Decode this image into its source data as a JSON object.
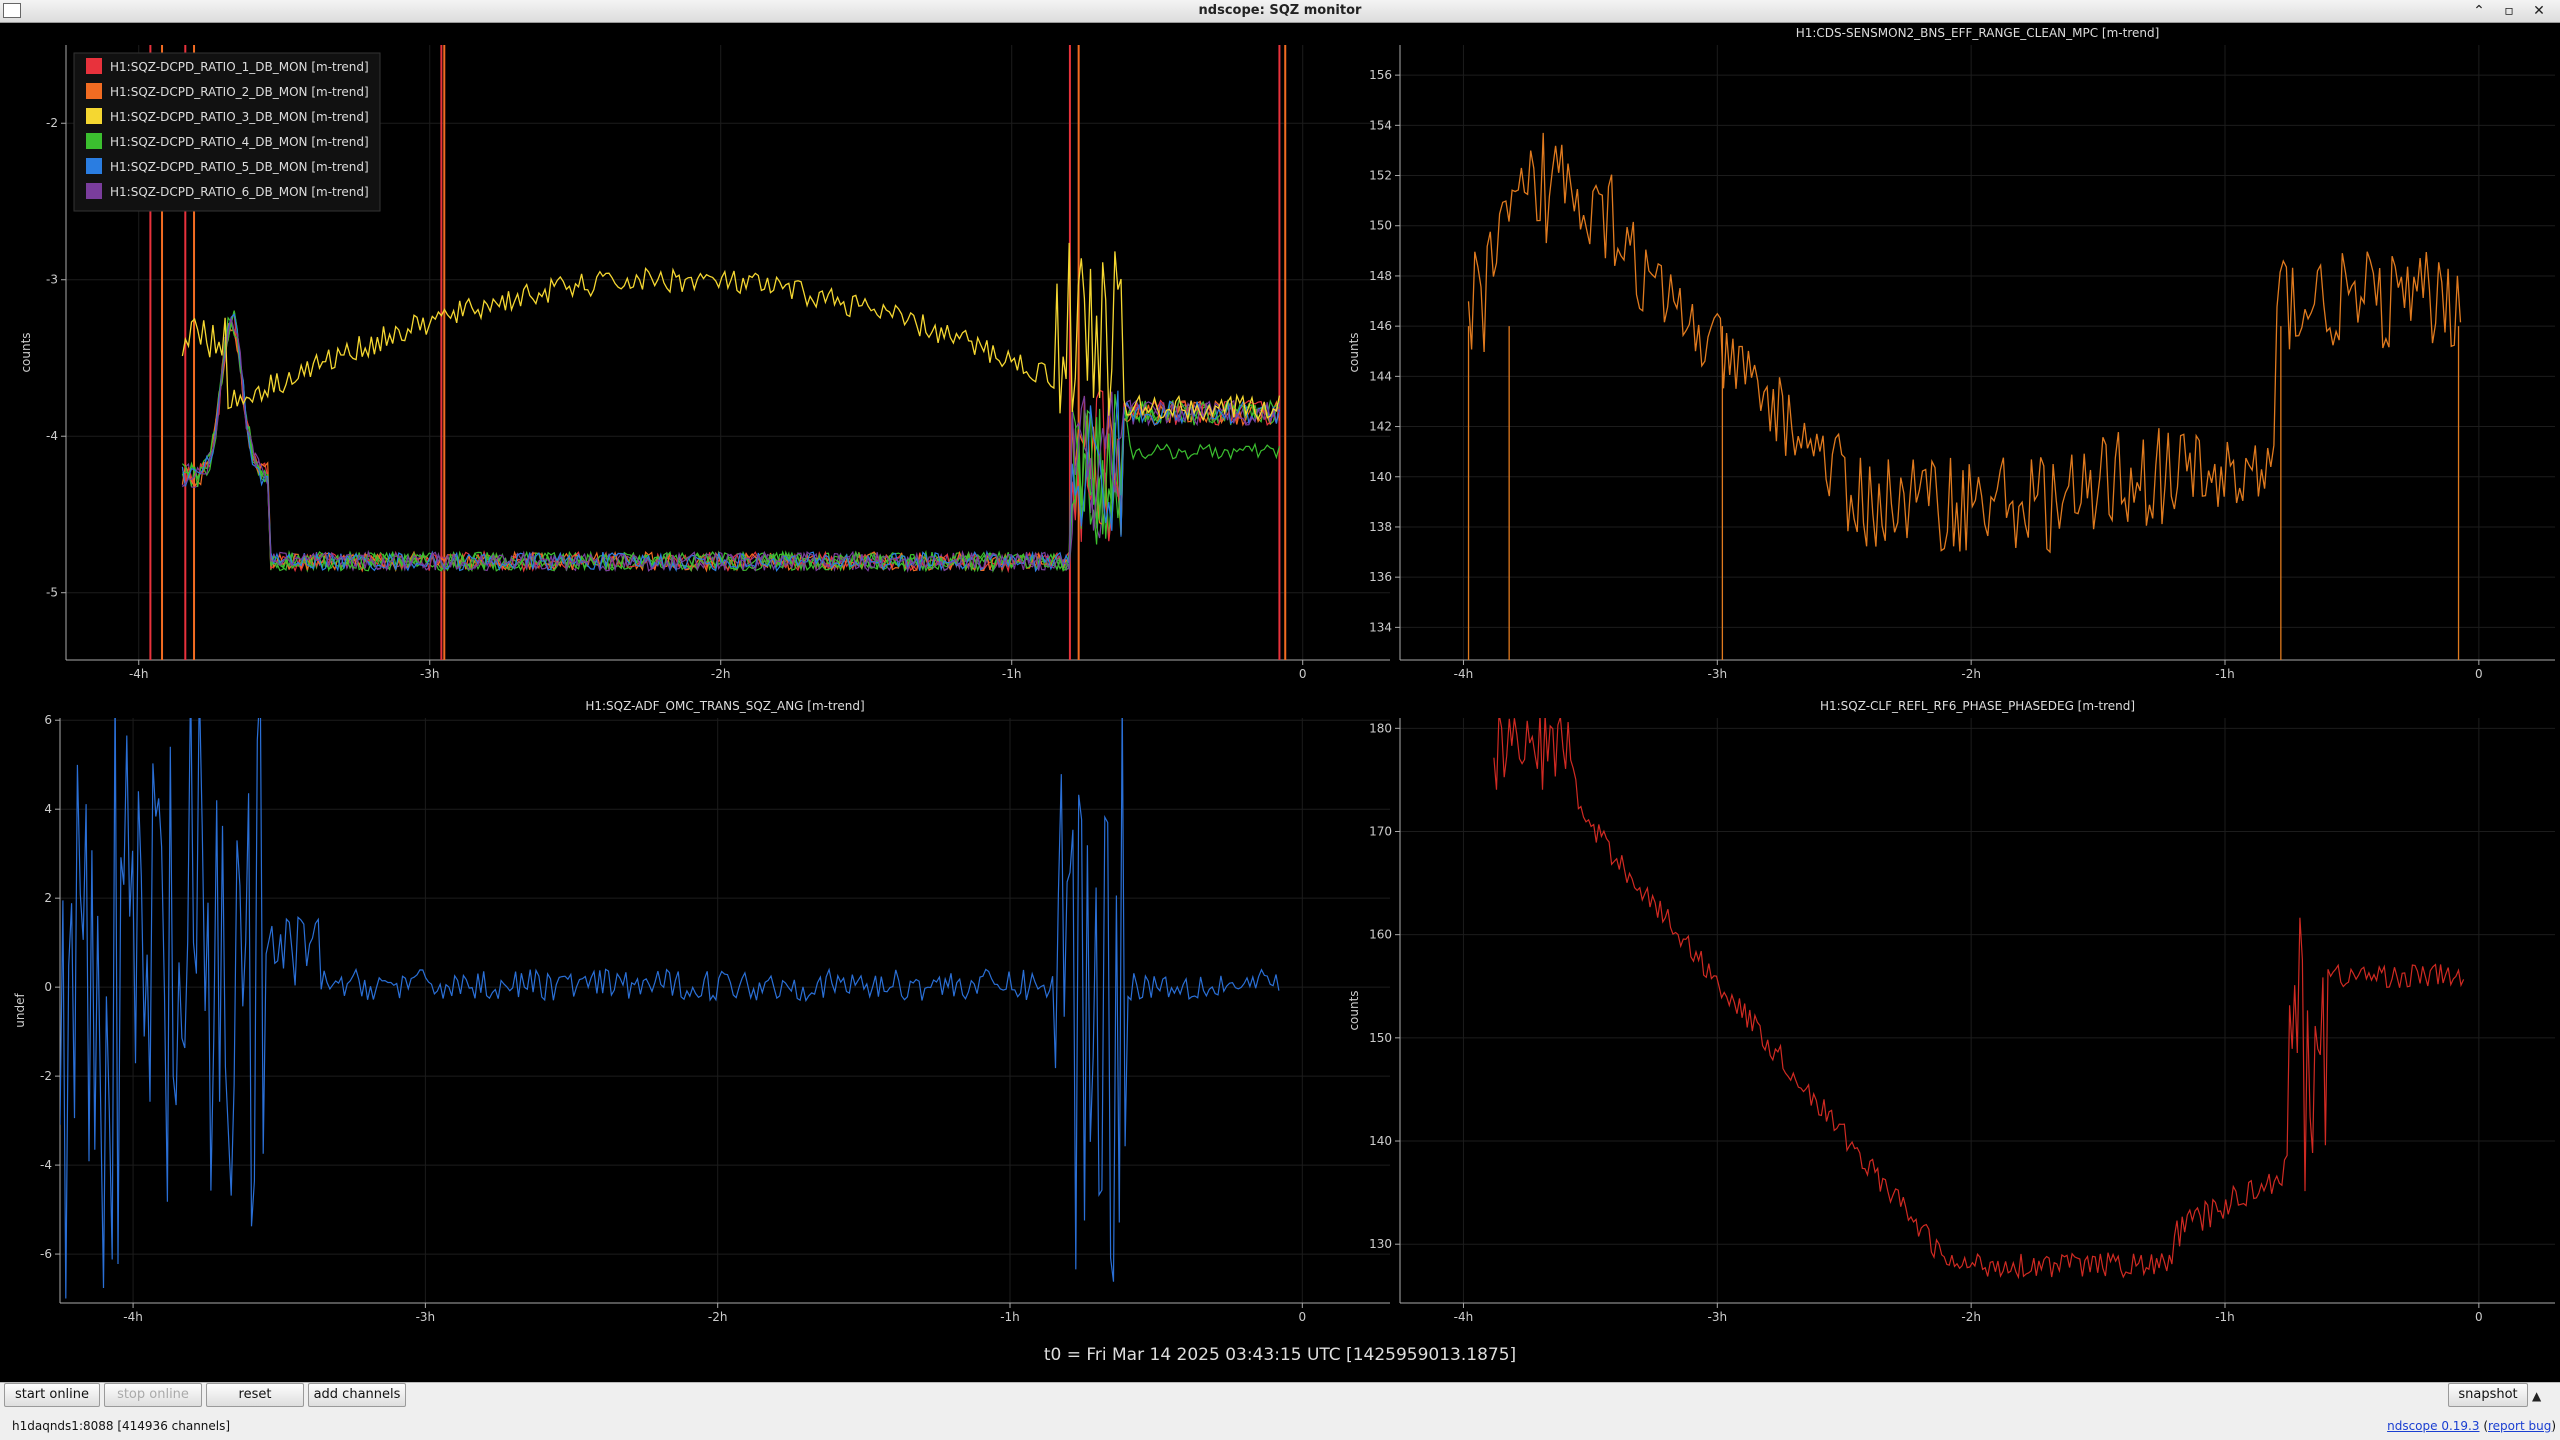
{
  "window": {
    "title": "ndscope: SQZ monitor",
    "controls": [
      "⌃",
      "▫",
      "✕"
    ]
  },
  "plots": [
    {
      "id": "p1",
      "title": "",
      "ylabel": "counts",
      "yticks": [
        -2,
        -3,
        -4,
        -5
      ],
      "ylim": [
        -5.43,
        -1.5
      ],
      "legend": [
        {
          "name": "H1:SQZ-DCPD_RATIO_1_DB_MON [m-trend]",
          "color": "#e8323c"
        },
        {
          "name": "H1:SQZ-DCPD_RATIO_2_DB_MON [m-trend]",
          "color": "#f26c22"
        },
        {
          "name": "H1:SQZ-DCPD_RATIO_3_DB_MON [m-trend]",
          "color": "#f5d731"
        },
        {
          "name": "H1:SQZ-DCPD_RATIO_4_DB_MON [m-trend]",
          "color": "#3bbf2f"
        },
        {
          "name": "H1:SQZ-DCPD_RATIO_5_DB_MON [m-trend]",
          "color": "#2a7de1"
        },
        {
          "name": "H1:SQZ-DCPD_RATIO_6_DB_MON [m-trend]",
          "color": "#7a3d9c"
        }
      ]
    },
    {
      "id": "p2",
      "title": "H1:CDS-SENSMON2_BNS_EFF_RANGE_CLEAN_MPC [m-trend]",
      "ylabel": "counts",
      "yticks": [
        156,
        154,
        152,
        150,
        148,
        146,
        144,
        142,
        140,
        138,
        136,
        134
      ],
      "ylim": [
        132.7,
        157.2
      ],
      "color": "#e07a1e"
    },
    {
      "id": "p3",
      "title": "H1:SQZ-ADF_OMC_TRANS_SQZ_ANG [m-trend]",
      "ylabel": "undef",
      "yticks": [
        6,
        4,
        2,
        0,
        -2,
        -4,
        -6
      ],
      "ylim": [
        -7.1,
        6.05
      ],
      "color": "#2a6fd6"
    },
    {
      "id": "p4",
      "title": "H1:SQZ-CLF_REFL_RF6_PHASE_PHASEDEG [m-trend]",
      "ylabel": "counts",
      "yticks": [
        180,
        170,
        160,
        150,
        140,
        130
      ],
      "ylim": [
        124.3,
        181
      ],
      "color": "#d02a22"
    }
  ],
  "xaxis": {
    "ticks": [
      "-4h",
      "-3h",
      "-2h",
      "-1h",
      "0"
    ],
    "tick_values_h": [
      -4,
      -3,
      -2,
      -1,
      0
    ],
    "xlim_h": [
      -4.25,
      0.3
    ]
  },
  "t0_label": "t0 = Fri Mar 14 2025 03:43:15 UTC [1425959013.1875]",
  "toolbar": {
    "start_online": "start online",
    "stop_online": "stop online",
    "reset": "reset",
    "add_channels": "add channels",
    "snapshot": "snapshot"
  },
  "status": {
    "server": "h1daqnds1:8088  [414936 channels]",
    "version_link": "ndscope 0.19.3",
    "bug_link": "report bug"
  }
}
